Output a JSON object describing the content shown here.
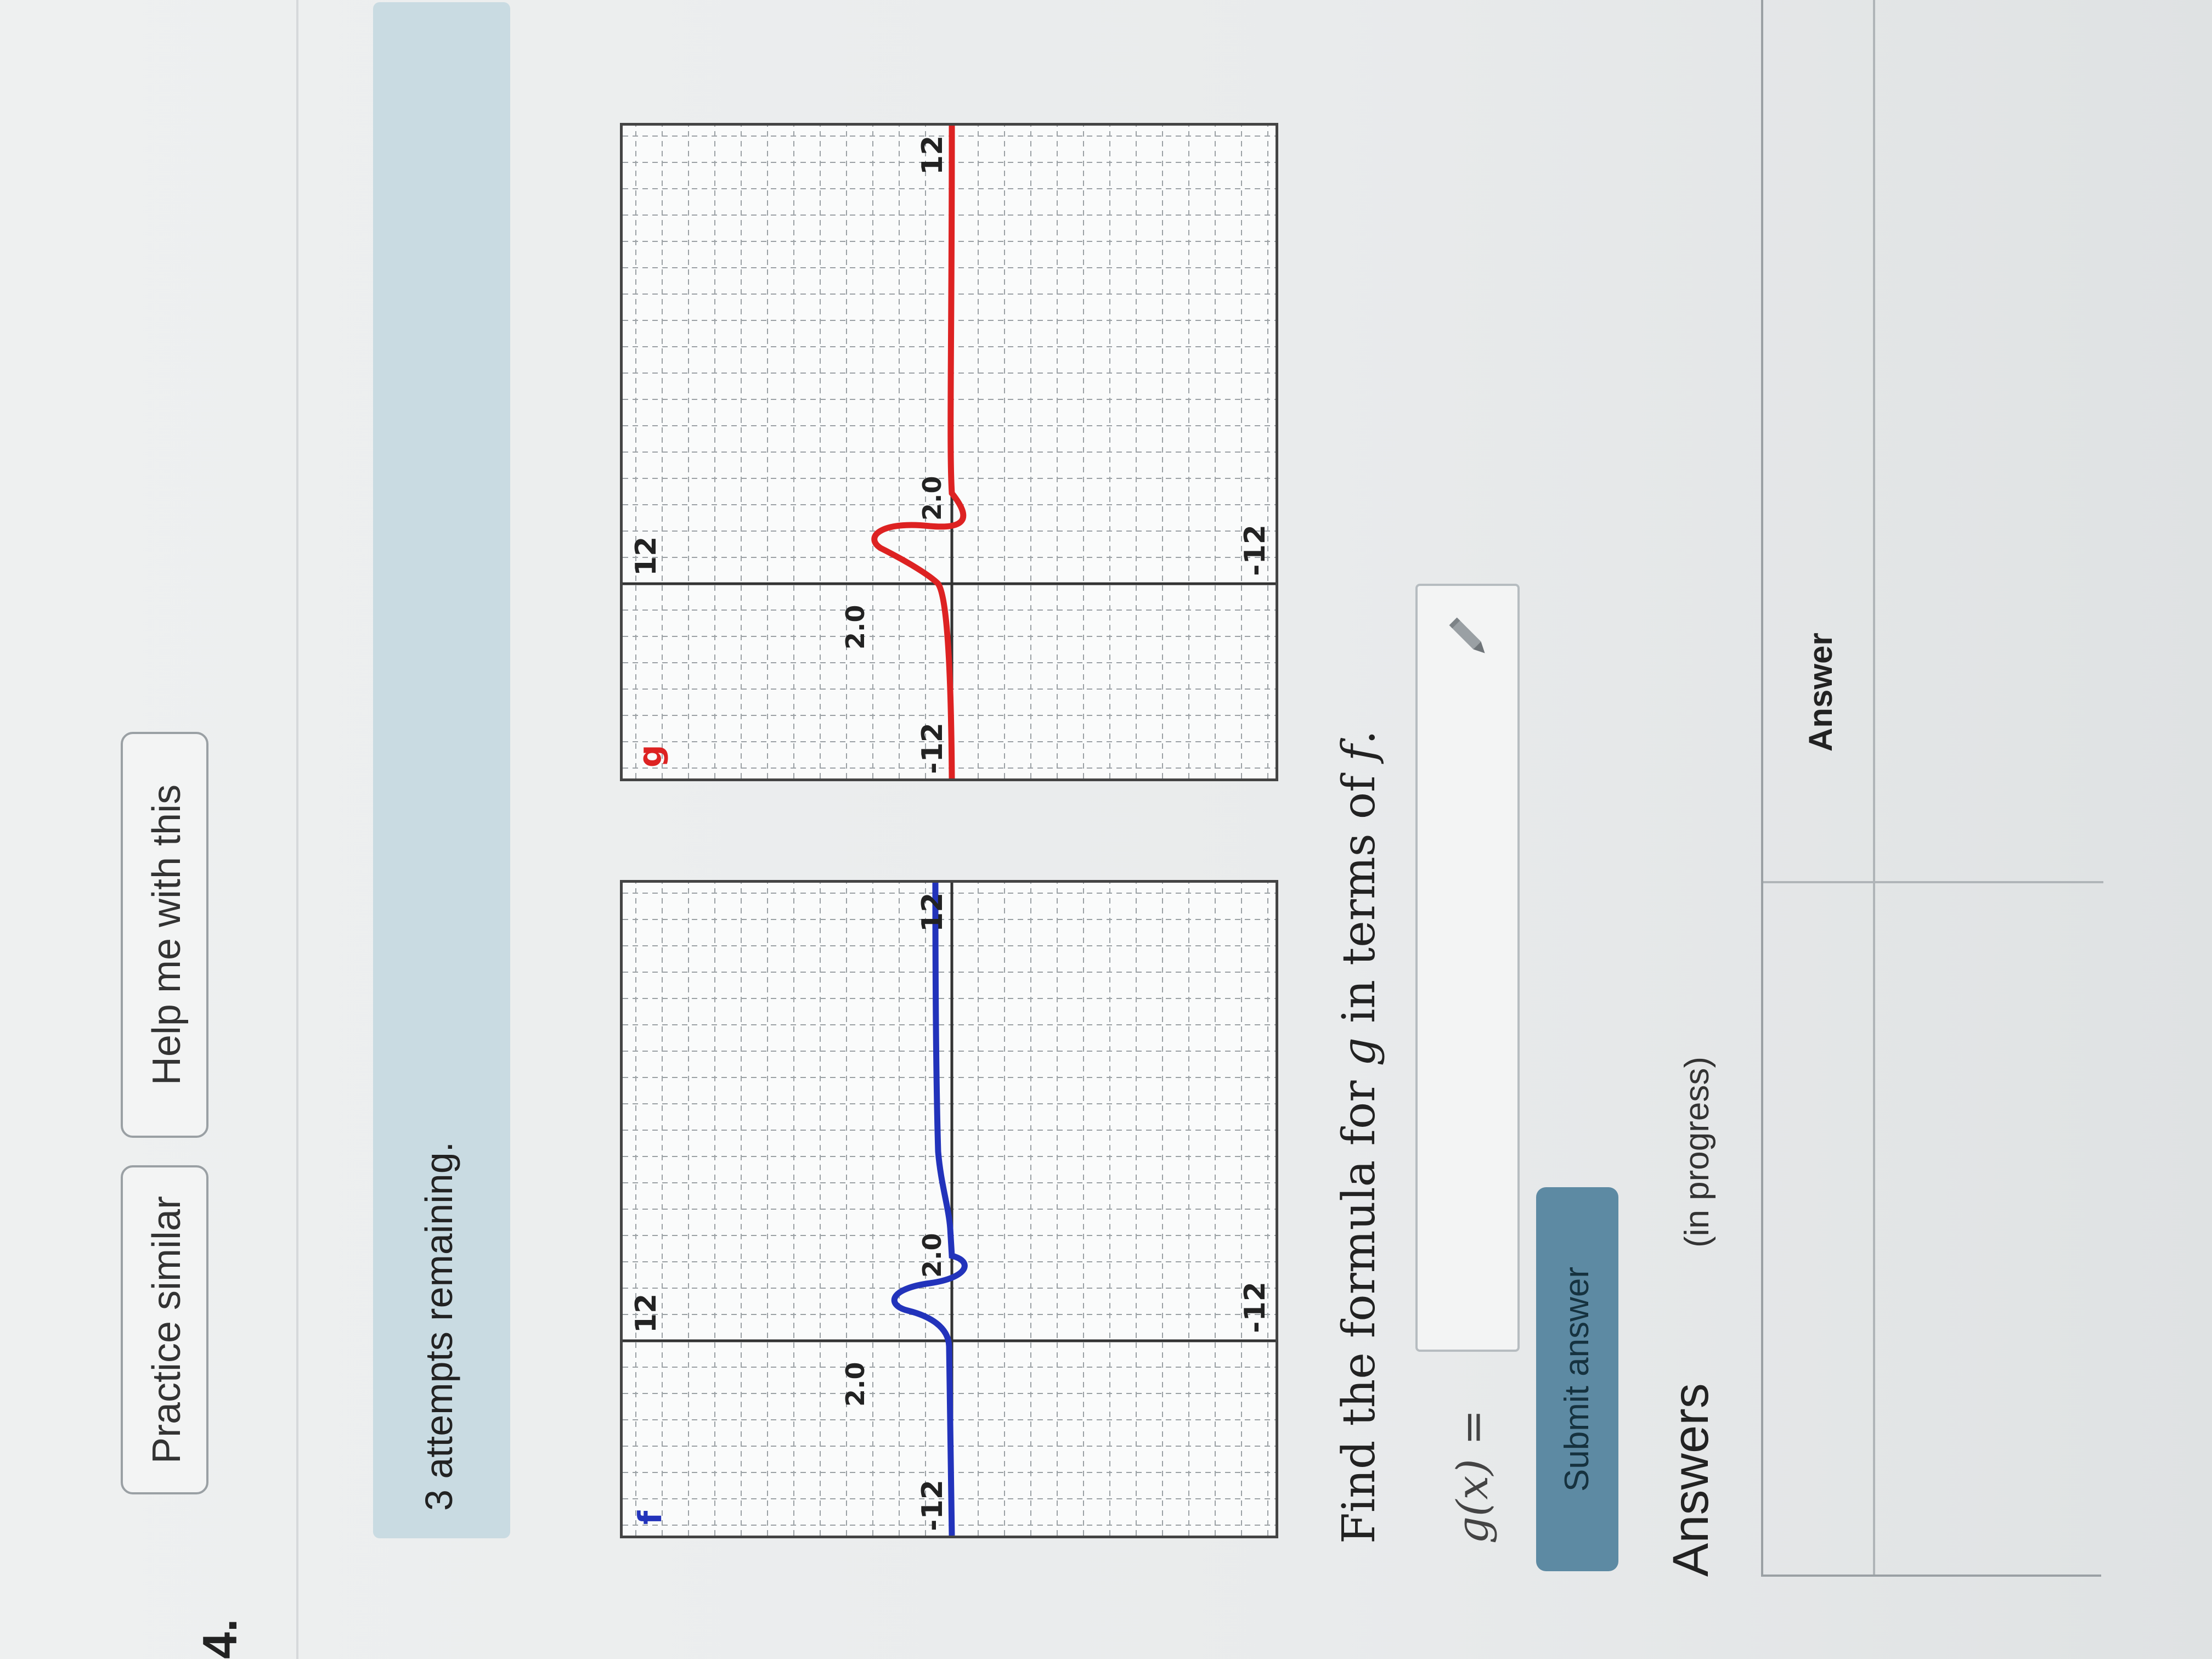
{
  "question": {
    "number": "4."
  },
  "toolbar": {
    "practice_similar_label": "Practice similar",
    "help_label": "Help me with this"
  },
  "status": {
    "attempts_text": "3 attempts remaining."
  },
  "graphs": [
    {
      "name": "f",
      "color": "#2233bb",
      "labels": {
        "x_min": "-12",
        "x_max": "12",
        "y_max": "12",
        "y_min": "-12",
        "x_point": "2.0",
        "y_point": "2.0"
      }
    },
    {
      "name": "g",
      "color": "#dd2222",
      "labels": {
        "x_min": "-12",
        "x_max": "12",
        "y_max": "12",
        "y_min": "-12",
        "x_point": "2.0",
        "y_point": "2.0"
      }
    }
  ],
  "prompt": {
    "before": "Find the formula for ",
    "var_g": "g",
    "middle": " in terms of ",
    "var_f": "f",
    "after": "."
  },
  "answer_field": {
    "label": "g(x) =",
    "value": ""
  },
  "submit": {
    "label": "Submit answer"
  },
  "answers_section": {
    "heading": "Answers",
    "status": "(in progress)",
    "column_header": "Answer"
  }
}
